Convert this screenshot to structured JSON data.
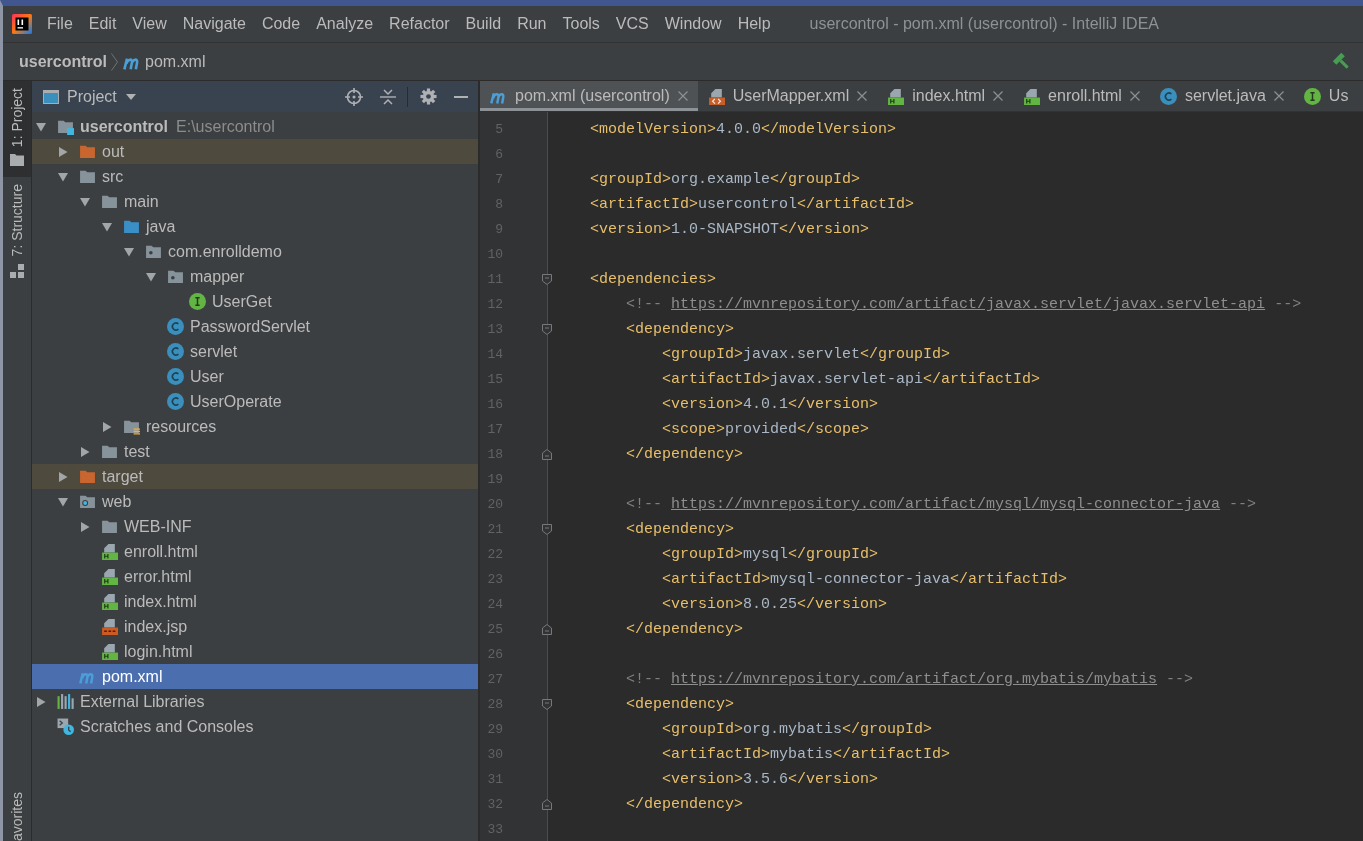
{
  "window": {
    "title": "usercontrol - pom.xml (usercontrol) - IntelliJ IDEA"
  },
  "menu": [
    "File",
    "Edit",
    "View",
    "Navigate",
    "Code",
    "Analyze",
    "Refactor",
    "Build",
    "Run",
    "Tools",
    "VCS",
    "Window",
    "Help"
  ],
  "breadcrumb": [
    {
      "label": "usercontrol"
    },
    {
      "label": "pom.xml",
      "kind": "maven"
    }
  ],
  "tool_strip": {
    "top": [
      {
        "label": "1: Project",
        "kind": "project",
        "selected": true
      },
      {
        "label": "7: Structure",
        "kind": "structure",
        "selected": false
      }
    ],
    "bottom": [
      {
        "label": "avorites",
        "selected": false
      }
    ]
  },
  "project": {
    "title": "Project",
    "tree": [
      {
        "name": "usercontrol",
        "path": "E:\\usercontrol",
        "kind": "module",
        "expanded": true,
        "selected": false,
        "children": [
          {
            "name": "out",
            "kind": "excluded",
            "expanded": false,
            "selected": false
          },
          {
            "name": "src",
            "kind": "folder",
            "expanded": true,
            "selected": false,
            "children": [
              {
                "name": "main",
                "kind": "folder",
                "expanded": true,
                "selected": false,
                "children": [
                  {
                    "name": "java",
                    "kind": "source",
                    "expanded": true,
                    "selected": false,
                    "children": [
                      {
                        "name": "com.enrolldemo",
                        "kind": "package",
                        "expanded": true,
                        "selected": false,
                        "children": [
                          {
                            "name": "mapper",
                            "kind": "package",
                            "expanded": true,
                            "selected": false,
                            "children": [
                              {
                                "name": "UserGet",
                                "kind": "interface",
                                "selected": false
                              }
                            ]
                          },
                          {
                            "name": "PasswordServlet",
                            "kind": "class",
                            "selected": false
                          },
                          {
                            "name": "servlet",
                            "kind": "class",
                            "selected": false
                          },
                          {
                            "name": "User",
                            "kind": "class",
                            "selected": false
                          },
                          {
                            "name": "UserOperate",
                            "kind": "class",
                            "selected": false
                          }
                        ]
                      }
                    ]
                  },
                  {
                    "name": "resources",
                    "kind": "resources",
                    "expanded": false,
                    "selected": false
                  }
                ]
              },
              {
                "name": "test",
                "kind": "folder",
                "expanded": false,
                "selected": false
              }
            ]
          },
          {
            "name": "target",
            "kind": "excluded",
            "expanded": false,
            "selected": false
          },
          {
            "name": "web",
            "kind": "web",
            "expanded": true,
            "selected": false,
            "children": [
              {
                "name": "WEB-INF",
                "kind": "folder",
                "expanded": false,
                "selected": false
              },
              {
                "name": "enroll.html",
                "kind": "html",
                "selected": false
              },
              {
                "name": "error.html",
                "kind": "html",
                "selected": false
              },
              {
                "name": "index.html",
                "kind": "html",
                "selected": false
              },
              {
                "name": "index.jsp",
                "kind": "jsp",
                "selected": false
              },
              {
                "name": "login.html",
                "kind": "html",
                "selected": false
              }
            ]
          },
          {
            "name": "pom.xml",
            "kind": "maven",
            "selected": true
          }
        ]
      },
      {
        "name": "External Libraries",
        "kind": "libraries",
        "expanded": false,
        "selected": false
      },
      {
        "name": "Scratches and Consoles",
        "kind": "scratches",
        "selected": false
      }
    ]
  },
  "editor": {
    "tabs": [
      {
        "label": "pom.xml (usercontrol)",
        "kind": "maven",
        "selected": true,
        "closable": true
      },
      {
        "label": "UserMapper.xml",
        "kind": "xml",
        "selected": false,
        "closable": true
      },
      {
        "label": "index.html",
        "kind": "html",
        "selected": false,
        "closable": true
      },
      {
        "label": "enroll.html",
        "kind": "html",
        "selected": false,
        "closable": true
      },
      {
        "label": "servlet.java",
        "kind": "class",
        "selected": false,
        "closable": true
      },
      {
        "label": "Us",
        "kind": "interface",
        "selected": false,
        "closable": false
      }
    ],
    "lines": [
      {
        "number": "5",
        "kind": "plain",
        "segments": [
          {
            "kind": "tag",
            "text": "    <modelVersion>"
          },
          {
            "kind": "text",
            "text": "4.0.0"
          },
          {
            "kind": "tag",
            "text": "</modelVersion>"
          }
        ]
      },
      {
        "number": "6",
        "kind": "plain"
      },
      {
        "number": "7",
        "kind": "plain",
        "segments": [
          {
            "kind": "tag",
            "text": "    <groupId>"
          },
          {
            "kind": "text",
            "text": "org.example"
          },
          {
            "kind": "tag",
            "text": "</groupId>"
          }
        ]
      },
      {
        "number": "8",
        "kind": "plain",
        "segments": [
          {
            "kind": "tag",
            "text": "    <artifactId>"
          },
          {
            "kind": "text",
            "text": "usercontrol"
          },
          {
            "kind": "tag",
            "text": "</artifactId>"
          }
        ]
      },
      {
        "number": "9",
        "kind": "plain",
        "segments": [
          {
            "kind": "tag",
            "text": "    <version>"
          },
          {
            "kind": "text",
            "text": "1.0-SNAPSHOT"
          },
          {
            "kind": "tag",
            "text": "</version>"
          }
        ]
      },
      {
        "number": "10",
        "kind": "plain"
      },
      {
        "number": "11",
        "kind": "fold-start",
        "segments": [
          {
            "kind": "tag",
            "text": "    <dependencies>"
          }
        ]
      },
      {
        "number": "12",
        "kind": "plain",
        "segments": [
          {
            "kind": "comment",
            "text": "        <!-- "
          },
          {
            "kind": "link",
            "text": "https://mvnrepository.com/artifact/javax.servlet/javax.servlet-api"
          },
          {
            "kind": "comment",
            "text": " -->"
          }
        ]
      },
      {
        "number": "13",
        "kind": "fold-start",
        "segments": [
          {
            "kind": "tag",
            "text": "        <dependency>"
          }
        ]
      },
      {
        "number": "14",
        "kind": "plain",
        "segments": [
          {
            "kind": "tag",
            "text": "            <groupId>"
          },
          {
            "kind": "text",
            "text": "javax.servlet"
          },
          {
            "kind": "tag",
            "text": "</groupId>"
          }
        ]
      },
      {
        "number": "15",
        "kind": "plain",
        "segments": [
          {
            "kind": "tag",
            "text": "            <artifactId>"
          },
          {
            "kind": "text",
            "text": "javax.servlet-api"
          },
          {
            "kind": "tag",
            "text": "</artifactId>"
          }
        ]
      },
      {
        "number": "16",
        "kind": "plain",
        "segments": [
          {
            "kind": "tag",
            "text": "            <version>"
          },
          {
            "kind": "text",
            "text": "4.0.1"
          },
          {
            "kind": "tag",
            "text": "</version>"
          }
        ]
      },
      {
        "number": "17",
        "kind": "plain",
        "segments": [
          {
            "kind": "tag",
            "text": "            <scope>"
          },
          {
            "kind": "text",
            "text": "provided"
          },
          {
            "kind": "tag",
            "text": "</scope>"
          }
        ]
      },
      {
        "number": "18",
        "kind": "fold-end",
        "segments": [
          {
            "kind": "tag",
            "text": "        </dependency>"
          }
        ]
      },
      {
        "number": "19",
        "kind": "plain"
      },
      {
        "number": "20",
        "kind": "plain",
        "segments": [
          {
            "kind": "comment",
            "text": "        <!-- "
          },
          {
            "kind": "link",
            "text": "https://mvnrepository.com/artifact/mysql/mysql-connector-java"
          },
          {
            "kind": "comment",
            "text": " -->"
          }
        ]
      },
      {
        "number": "21",
        "kind": "fold-start",
        "segments": [
          {
            "kind": "tag",
            "text": "        <dependency>"
          }
        ]
      },
      {
        "number": "22",
        "kind": "plain",
        "segments": [
          {
            "kind": "tag",
            "text": "            <groupId>"
          },
          {
            "kind": "text",
            "text": "mysql"
          },
          {
            "kind": "tag",
            "text": "</groupId>"
          }
        ]
      },
      {
        "number": "23",
        "kind": "plain",
        "segments": [
          {
            "kind": "tag",
            "text": "            <artifactId>"
          },
          {
            "kind": "text",
            "text": "mysql-connector-java"
          },
          {
            "kind": "tag",
            "text": "</artifactId>"
          }
        ]
      },
      {
        "number": "24",
        "kind": "plain",
        "segments": [
          {
            "kind": "tag",
            "text": "            <version>"
          },
          {
            "kind": "text",
            "text": "8.0.25"
          },
          {
            "kind": "tag",
            "text": "</version>"
          }
        ]
      },
      {
        "number": "25",
        "kind": "fold-end",
        "segments": [
          {
            "kind": "tag",
            "text": "        </dependency>"
          }
        ]
      },
      {
        "number": "26",
        "kind": "plain"
      },
      {
        "number": "27",
        "kind": "plain",
        "segments": [
          {
            "kind": "comment",
            "text": "        <!-- "
          },
          {
            "kind": "link",
            "text": "https://mvnrepository.com/artifact/org.mybatis/mybatis"
          },
          {
            "kind": "comment",
            "text": " -->"
          }
        ]
      },
      {
        "number": "28",
        "kind": "fold-start",
        "segments": [
          {
            "kind": "tag",
            "text": "        <dependency>"
          }
        ]
      },
      {
        "number": "29",
        "kind": "plain",
        "segments": [
          {
            "kind": "tag",
            "text": "            <groupId>"
          },
          {
            "kind": "text",
            "text": "org.mybatis"
          },
          {
            "kind": "tag",
            "text": "</groupId>"
          }
        ]
      },
      {
        "number": "30",
        "kind": "plain",
        "segments": [
          {
            "kind": "tag",
            "text": "            <artifactId>"
          },
          {
            "kind": "text",
            "text": "mybatis"
          },
          {
            "kind": "tag",
            "text": "</artifactId>"
          }
        ]
      },
      {
        "number": "31",
        "kind": "plain",
        "segments": [
          {
            "kind": "tag",
            "text": "            <version>"
          },
          {
            "kind": "text",
            "text": "3.5.6"
          },
          {
            "kind": "tag",
            "text": "</version>"
          }
        ]
      },
      {
        "number": "32",
        "kind": "fold-end",
        "segments": [
          {
            "kind": "tag",
            "text": "        </dependency>"
          }
        ]
      },
      {
        "number": "33",
        "kind": "plain"
      }
    ]
  }
}
